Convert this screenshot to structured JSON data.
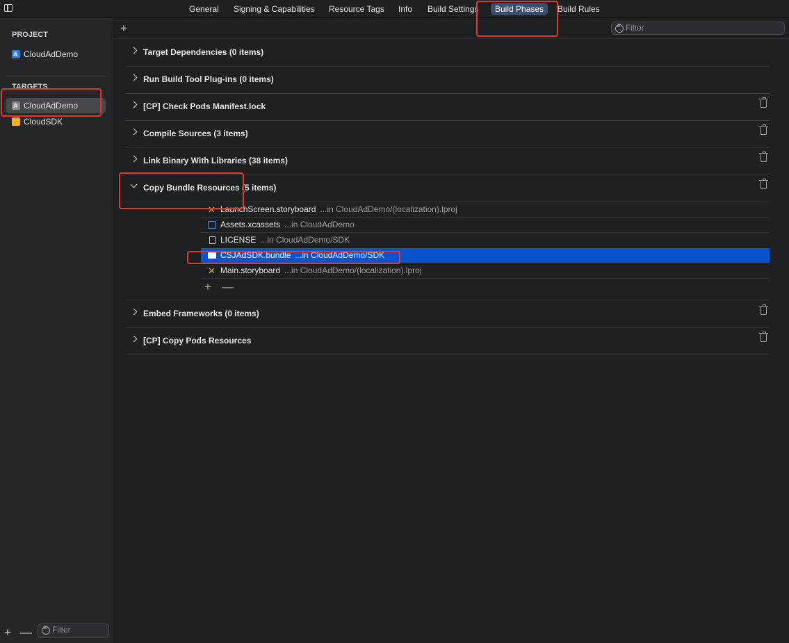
{
  "tabs": [
    "General",
    "Signing & Capabilities",
    "Resource Tags",
    "Info",
    "Build Settings",
    "Build Phases",
    "Build Rules"
  ],
  "active_tab": "Build Phases",
  "search": {
    "placeholder": "Filter"
  },
  "sidebar": {
    "project_heading": "PROJECT",
    "project_name": "CloudAdDemo",
    "targets_heading": "TARGETS",
    "targets": [
      {
        "label": "CloudAdDemo",
        "icon": "app-target-icon",
        "selected": true
      },
      {
        "label": "CloudSDK",
        "icon": "framework-icon",
        "selected": false
      }
    ],
    "filter_placeholder": "Filter",
    "add_label": "+",
    "remove_label": "—"
  },
  "toolbar": {
    "add_label": "+"
  },
  "phases": [
    {
      "title": "Target Dependencies (0 items)",
      "expanded": false,
      "deletable": false
    },
    {
      "title": "Run Build Tool Plug-ins (0 items)",
      "expanded": false,
      "deletable": false
    },
    {
      "title": "[CP] Check Pods Manifest.lock",
      "expanded": false,
      "deletable": true
    },
    {
      "title": "Compile Sources (3 items)",
      "expanded": false,
      "deletable": true
    },
    {
      "title": "Link Binary With Libraries (38 items)",
      "expanded": false,
      "deletable": true
    },
    {
      "title": "Copy Bundle Resources (5 items)",
      "expanded": true,
      "deletable": true
    },
    {
      "title": "Embed Frameworks (0 items)",
      "expanded": false,
      "deletable": true
    },
    {
      "title": "[CP] Copy Pods Resources",
      "expanded": false,
      "deletable": true
    }
  ],
  "resources": [
    {
      "name": "LaunchScreen.storyboard",
      "path": "...in CloudAdDemo/(localization).lproj",
      "icon": "storyboard-icon",
      "selected": false
    },
    {
      "name": "Assets.xcassets",
      "path": "...in CloudAdDemo",
      "icon": "assets-icon",
      "selected": false
    },
    {
      "name": "LICENSE",
      "path": "...in CloudAdDemo/SDK",
      "icon": "document-icon",
      "selected": false
    },
    {
      "name": "CSJAdSDK.bundle",
      "path": "...in CloudAdDemo/SDK",
      "icon": "folder-icon",
      "selected": true
    },
    {
      "name": "Main.storyboard",
      "path": "...in CloudAdDemo/(localization).lproj",
      "icon": "storyboard-icon",
      "selected": false
    }
  ],
  "resources_add": "+",
  "resources_remove": "—",
  "colors": {
    "selection": "#0a53cf",
    "annotation": "#e03a2c",
    "active_tab": "#3a4e6b"
  }
}
